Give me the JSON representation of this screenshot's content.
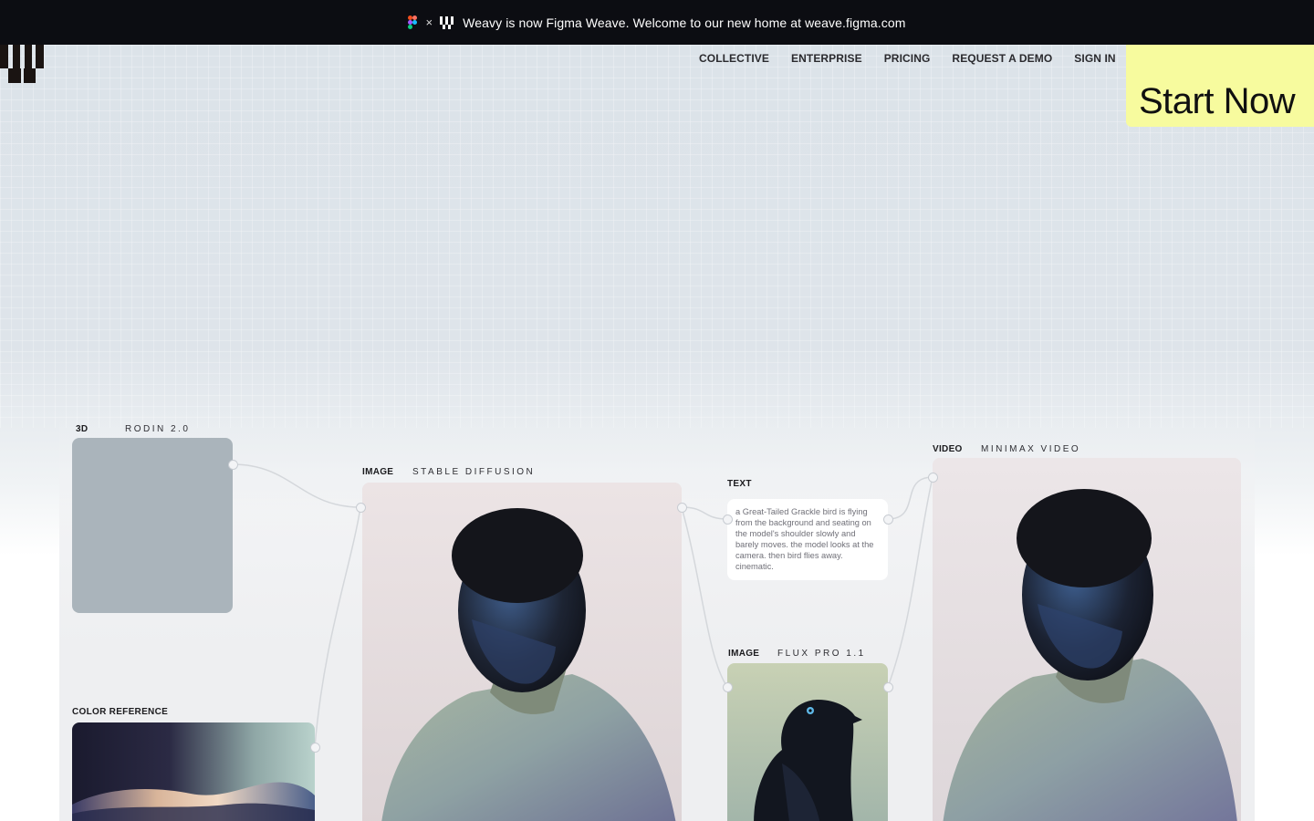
{
  "banner": {
    "text": "Weavy is now Figma Weave. Welcome to our new home at weave.figma.com",
    "figma_icon": "figma-icon",
    "times": "×",
    "weave_icon": "weave-logo-icon"
  },
  "nav": {
    "items": [
      "COLLECTIVE",
      "ENTERPRISE",
      "PRICING",
      "REQUEST A DEMO",
      "SIGN IN"
    ]
  },
  "cta": {
    "label": "Start Now",
    "color": "#f7fb9e"
  },
  "nodes": {
    "rodin": {
      "type": "3D",
      "model": "RODIN 2.0"
    },
    "stable": {
      "type": "IMAGE",
      "model": "STABLE DIFFUSION"
    },
    "text": {
      "type": "TEXT",
      "prompt": "a Great-Tailed Grackle bird is flying from the background and seating on the model's shoulder slowly and barely moves. the model looks at the camera. then bird flies away. cinematic."
    },
    "flux": {
      "type": "IMAGE",
      "model": "FLUX PRO 1.1"
    },
    "video": {
      "type": "VIDEO",
      "model": "MINIMAX VIDEO"
    },
    "color_ref": {
      "type": "COLOR REFERENCE"
    }
  }
}
